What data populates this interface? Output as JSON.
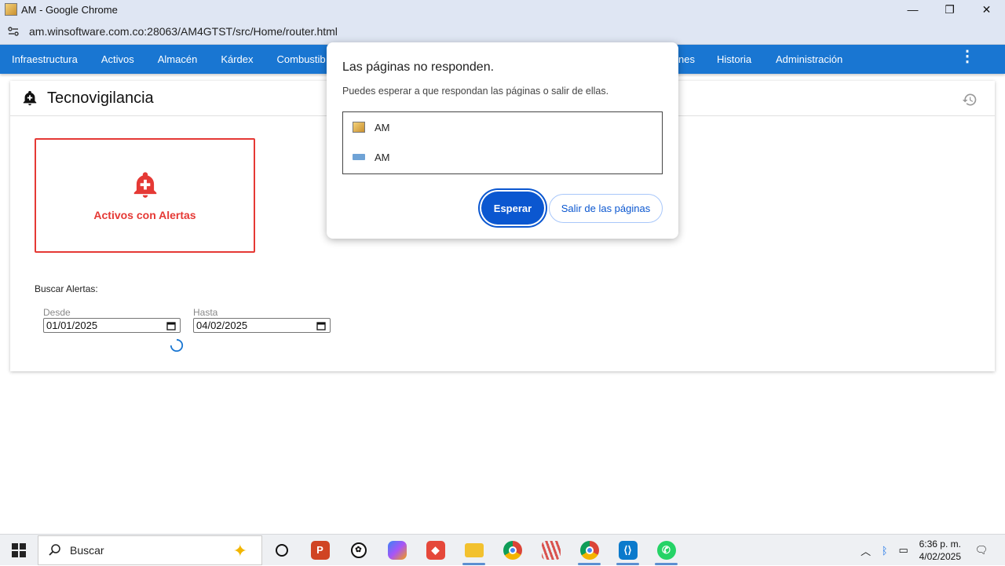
{
  "window": {
    "title": "AM - Google Chrome",
    "controls": {
      "minimize": "—",
      "restore": "❐",
      "close": "✕"
    }
  },
  "addressbar": {
    "url": "am.winsoftware.com.co:28063/AM4GTST/src/Home/router.html"
  },
  "nav": {
    "items": [
      "Infraestructura",
      "Activos",
      "Almacén",
      "Kárdex",
      "Combustib",
      "nes",
      "Historia",
      "Administración"
    ],
    "more": "⋮"
  },
  "card": {
    "title": "Tecnovigilancia",
    "alert_tile_label": "Activos con Alertas",
    "search_label": "Buscar Alertas:",
    "from": {
      "label": "Desde",
      "value": "01/01/2025"
    },
    "to": {
      "label": "Hasta",
      "value": "04/02/2025"
    }
  },
  "dialog": {
    "title": "Las páginas no responden.",
    "description": "Puedes esperar a que respondan las páginas o salir de ellas.",
    "pages": [
      "AM",
      "AM"
    ],
    "wait_button": "Esperar",
    "leave_button": "Salir de las páginas"
  },
  "taskbar": {
    "search_text": "Buscar",
    "time": "6:36 p. m.",
    "date": "4/02/2025"
  },
  "colors": {
    "nav": "#1976d2",
    "alert": "#e53935",
    "primary_button": "#0b57d0"
  }
}
